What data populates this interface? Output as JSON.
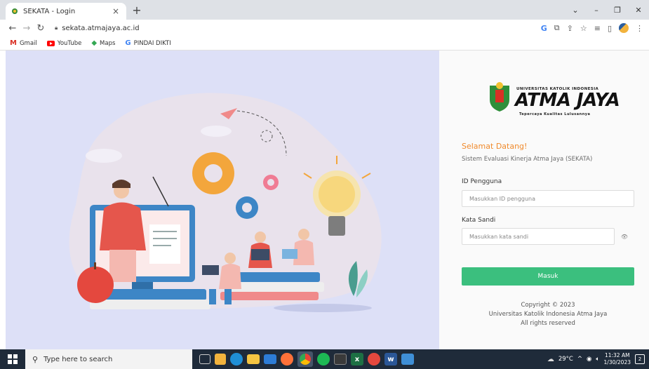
{
  "browser": {
    "tab_title": "SEKATA - Login",
    "tab_close": "×",
    "new_tab": "+",
    "url": "sekata.atmajaya.ac.id",
    "bookmarks": [
      {
        "label": "Gmail",
        "icon": "gmail-icon"
      },
      {
        "label": "YouTube",
        "icon": "youtube-icon"
      },
      {
        "label": "Maps",
        "icon": "maps-icon"
      },
      {
        "label": "PINDAI DIKTI",
        "icon": "pindai-icon"
      }
    ]
  },
  "logo": {
    "small_text": "UNIVERSITAS KATOLIK INDONESIA",
    "big_text": "ATMA JAYA",
    "tagline": "Tepercaya Kualitas Lulusannya"
  },
  "login": {
    "welcome": "Selamat Datang!",
    "subtitle": "Sistem Evaluasi Kinerja Atma Jaya (SEKATA)",
    "id_label": "ID Pengguna",
    "id_placeholder": "Masukkan ID pengguna",
    "password_label": "Kata Sandi",
    "password_placeholder": "Masukkan kata sandi",
    "submit_label": "Masuk",
    "copyright_line1": "Copyright © 2023",
    "copyright_line2": "Universitas Katolik Indonesia Atma Jaya",
    "copyright_line3": "All rights reserved"
  },
  "taskbar": {
    "search_placeholder": "Type here to search",
    "temperature": "29°C",
    "time": "11:32 AM",
    "date": "1/30/2023",
    "notification_count": "2"
  },
  "colors": {
    "accent_orange": "#f08a2c",
    "button_green": "#3bbf7e",
    "illustration_bg": "#dde0f7"
  }
}
